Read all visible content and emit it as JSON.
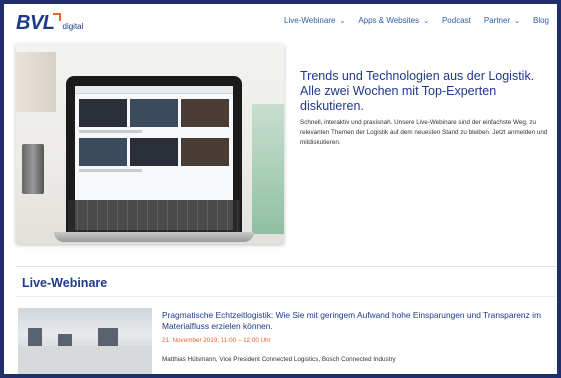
{
  "header": {
    "logo_text": "BVL",
    "logo_sub": "digital",
    "nav": [
      {
        "label": "Live-Webinare",
        "dropdown": true
      },
      {
        "label": "Apps & Websites",
        "dropdown": true
      },
      {
        "label": "Podcast",
        "dropdown": false
      },
      {
        "label": "Partner",
        "dropdown": true
      },
      {
        "label": "Blog",
        "dropdown": false
      }
    ],
    "chevron": "⌄"
  },
  "hero": {
    "title": "Trends und Technologien aus der Logistik. Alle zwei Wochen mit Top-Experten diskutieren.",
    "text": "Schnell, interaktiv und praxisnah. Unsere Live-Webinare sind der einfachste Weg, zu relevanten Themen der Logistik auf dem neuesten Stand zu bleiben. Jetzt anmelden und mitdiskutieren."
  },
  "section": {
    "title": "Live-Webinare"
  },
  "webinar": {
    "title": "Pragmatische Echtzeitlogistik: Wie Sie mit geringem Aufwand hohe Einsparungen und Transparenz im Materialfluss erzielen können.",
    "date": "21. November 2019, 11:00 – 12:00 Uhr",
    "speaker": "Matthias Hülsmann, Vice President Connected Logistics, Bosch Connected Industry"
  },
  "colors": {
    "brand_blue": "#1e3a8a",
    "accent_orange": "#e8632a",
    "link_blue": "#2f5fa8",
    "frame": "#1e2f6b"
  }
}
